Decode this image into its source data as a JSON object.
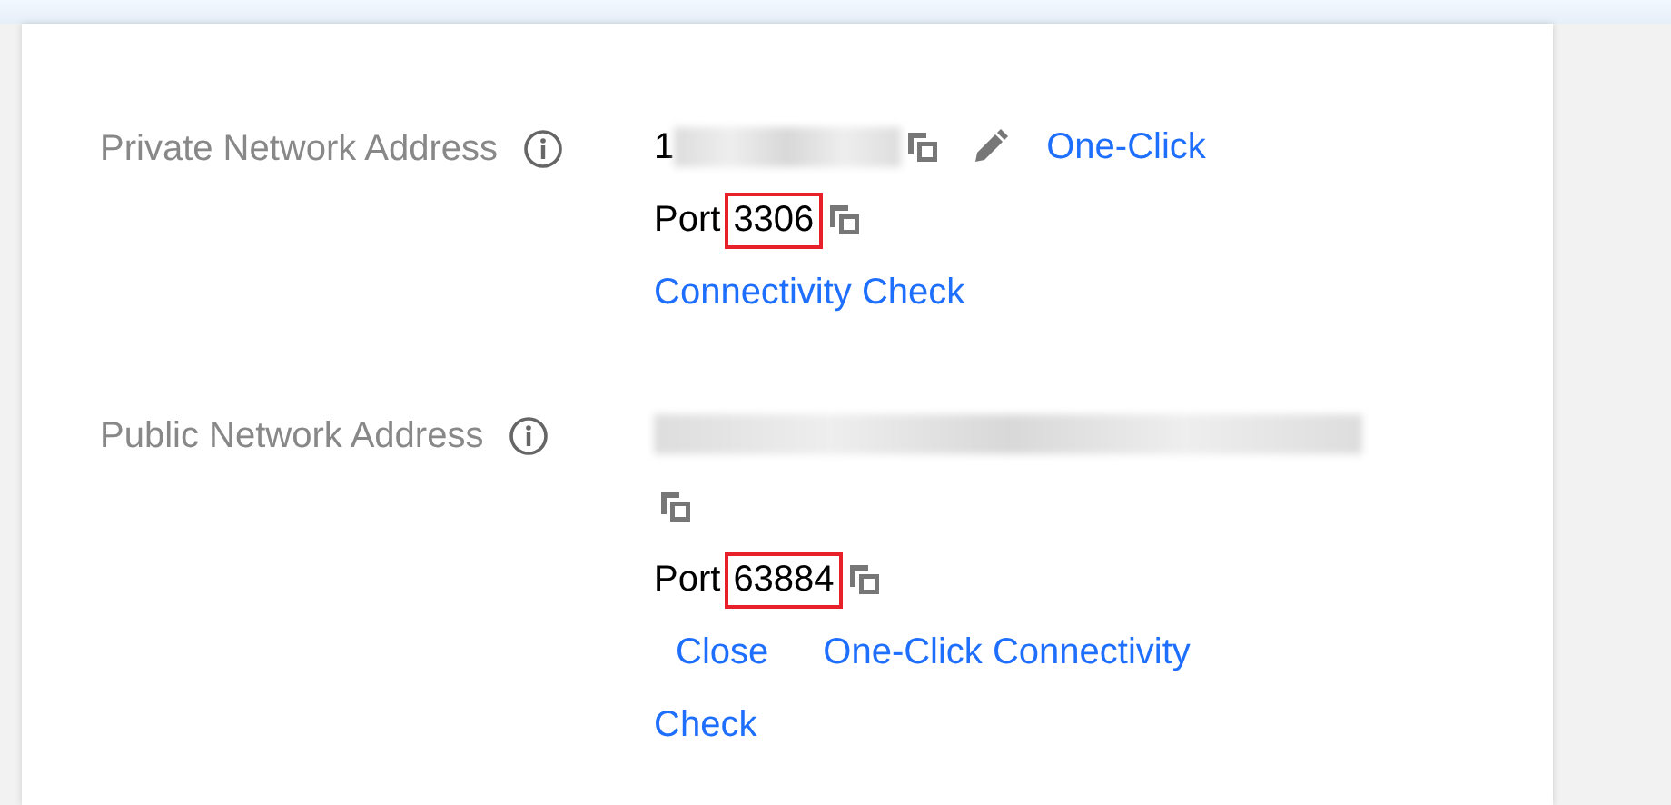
{
  "sections": [
    {
      "label": "Private Network Address",
      "lines": [
        [
          {
            "kind": "text",
            "text": "1"
          },
          {
            "kind": "redacted"
          },
          {
            "kind": "copy"
          },
          {
            "kind": "edit"
          },
          {
            "kind": "link",
            "text": "One-Click"
          }
        ],
        [
          {
            "kind": "port",
            "label": "Port",
            "value": "3306",
            "highlighted": true
          },
          {
            "kind": "copy"
          }
        ],
        [
          {
            "kind": "link",
            "text": "Connectivity Check"
          }
        ]
      ]
    },
    {
      "label": "Public Network Address",
      "lines": [
        [
          {
            "kind": "redacted"
          }
        ],
        [
          {
            "kind": "copy"
          }
        ],
        [
          {
            "kind": "port",
            "label": "Port",
            "value": "63884",
            "highlighted": true
          },
          {
            "kind": "copy"
          }
        ],
        [
          {
            "kind": "link",
            "text": "Close"
          },
          {
            "kind": "link",
            "text": "One-Click Connectivity"
          }
        ],
        [
          {
            "kind": "link",
            "text": "Check"
          }
        ]
      ]
    }
  ]
}
